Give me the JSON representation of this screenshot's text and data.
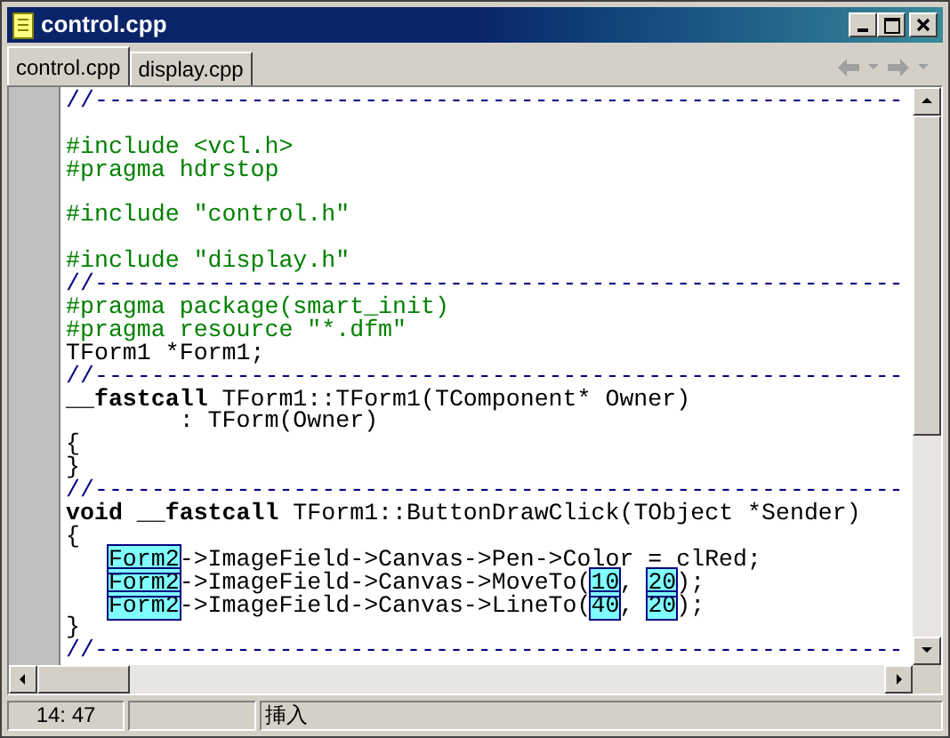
{
  "window": {
    "title": "control.cpp"
  },
  "tabs": [
    {
      "label": "control.cpp",
      "selected": true
    },
    {
      "label": "display.cpp",
      "selected": false
    }
  ],
  "nav": {
    "back_disabled": true,
    "forward_disabled": true
  },
  "editor": {
    "lines": [
      {
        "kind": "code",
        "tokens": [
          {
            "text": "//---------------------------------------------------------",
            "kind": "comment"
          }
        ]
      },
      {
        "kind": "blank"
      },
      {
        "kind": "code",
        "tokens": [
          {
            "text": "#include <vcl.h>",
            "kind": "directive"
          }
        ]
      },
      {
        "kind": "code",
        "tokens": [
          {
            "text": "#pragma hdrstop",
            "kind": "directive"
          }
        ]
      },
      {
        "kind": "blank"
      },
      {
        "kind": "code",
        "tokens": [
          {
            "text": "#include \"control.h\"",
            "kind": "directive"
          }
        ]
      },
      {
        "kind": "blank"
      },
      {
        "kind": "code",
        "tokens": [
          {
            "text": "#include \"display.h\"",
            "kind": "directive"
          }
        ]
      },
      {
        "kind": "code",
        "tokens": [
          {
            "text": "//---------------------------------------------------------",
            "kind": "comment"
          }
        ]
      },
      {
        "kind": "code",
        "tokens": [
          {
            "text": "#pragma package(smart_init)",
            "kind": "directive"
          }
        ]
      },
      {
        "kind": "code",
        "tokens": [
          {
            "text": "#pragma resource \"*.dfm\"",
            "kind": "directive"
          }
        ]
      },
      {
        "kind": "code",
        "tokens": [
          {
            "text": "TForm1 *Form1;",
            "kind": "plain"
          }
        ]
      },
      {
        "kind": "code",
        "tokens": [
          {
            "text": "//---------------------------------------------------------",
            "kind": "comment"
          }
        ]
      },
      {
        "kind": "code",
        "tokens": [
          {
            "text": "__fastcall",
            "kind": "keyword"
          },
          {
            "text": " TForm1::TForm1(TComponent* Owner)",
            "kind": "plain"
          }
        ]
      },
      {
        "kind": "code",
        "tokens": [
          {
            "text": "        : TForm(Owner)",
            "kind": "plain"
          }
        ]
      },
      {
        "kind": "code",
        "tokens": [
          {
            "text": "{",
            "kind": "plain"
          }
        ]
      },
      {
        "kind": "code",
        "tokens": [
          {
            "text": "}",
            "kind": "plain"
          }
        ]
      },
      {
        "kind": "code",
        "tokens": [
          {
            "text": "//---------------------------------------------------------",
            "kind": "comment"
          }
        ]
      },
      {
        "kind": "code",
        "tokens": [
          {
            "text": "void __fastcall",
            "kind": "keyword"
          },
          {
            "text": " TForm1::ButtonDrawClick(TObject *Sender)",
            "kind": "plain"
          }
        ]
      },
      {
        "kind": "code",
        "tokens": [
          {
            "text": "{",
            "kind": "plain"
          }
        ]
      },
      {
        "kind": "indented",
        "tokens": [
          {
            "text": "Form2",
            "kind": "highlight"
          },
          {
            "text": "->ImageField->Canvas->Pen->Color = clRed;",
            "kind": "plain"
          }
        ]
      },
      {
        "kind": "indented",
        "tokens": [
          {
            "text": "Form2",
            "kind": "highlight"
          },
          {
            "text": "->ImageField->Canvas->MoveTo(",
            "kind": "plain"
          },
          {
            "text": "10",
            "kind": "highlight"
          },
          {
            "text": ", ",
            "kind": "plain"
          },
          {
            "text": "20",
            "kind": "highlight"
          },
          {
            "text": ");",
            "kind": "plain"
          }
        ]
      },
      {
        "kind": "indented",
        "tokens": [
          {
            "text": "Form2",
            "kind": "highlight"
          },
          {
            "text": "->ImageField->Canvas->LineTo(",
            "kind": "plain"
          },
          {
            "text": "40",
            "kind": "highlight"
          },
          {
            "text": ", ",
            "kind": "plain"
          },
          {
            "text": "20",
            "kind": "highlight"
          },
          {
            "text": ");",
            "kind": "plain"
          }
        ]
      },
      {
        "kind": "code",
        "tokens": [
          {
            "text": "}",
            "kind": "plain"
          }
        ]
      },
      {
        "kind": "code",
        "tokens": [
          {
            "text": "//---------------------------------------------------------",
            "kind": "comment"
          }
        ]
      }
    ]
  },
  "status_bar": {
    "position": "14: 47",
    "mode": "挿入"
  }
}
